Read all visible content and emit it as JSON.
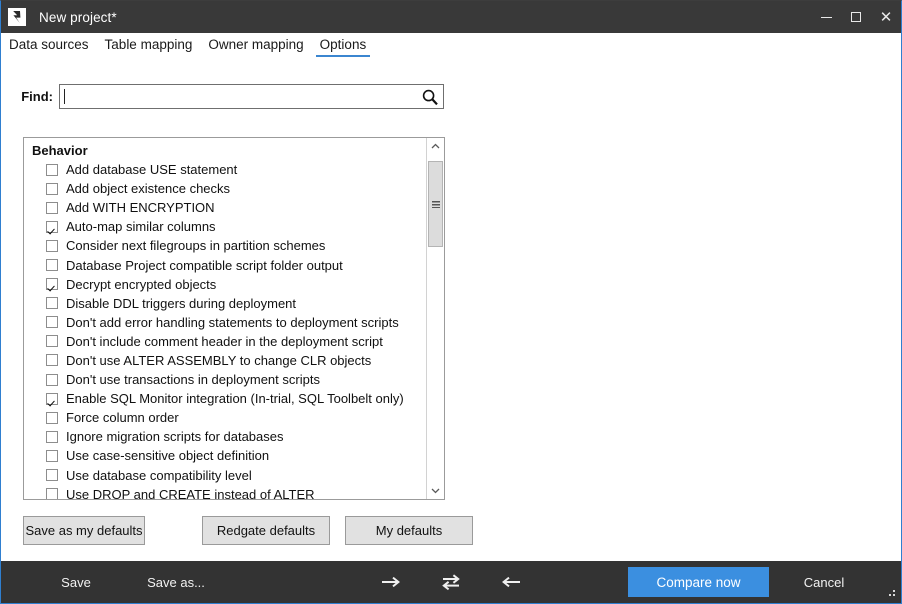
{
  "window": {
    "title": "New project*",
    "logo_icon": "redgate-s-logo-icon",
    "minimize_icon": "minimize-icon",
    "maximize_icon": "maximize-icon",
    "close_icon": "close-icon",
    "titlebar_color": "#393939",
    "accent_color": "#3b86d0"
  },
  "tabs": [
    {
      "label": "Data sources",
      "active": false
    },
    {
      "label": "Table mapping",
      "active": false
    },
    {
      "label": "Owner mapping",
      "active": false
    },
    {
      "label": "Options",
      "active": true
    }
  ],
  "find": {
    "label": "Find:",
    "value": "",
    "placeholder": "",
    "search_icon": "search-icon"
  },
  "options_list": {
    "group_header": "Behavior",
    "items": [
      {
        "label": "Add database USE statement",
        "checked": false
      },
      {
        "label": "Add object existence checks",
        "checked": false
      },
      {
        "label": "Add WITH ENCRYPTION",
        "checked": false
      },
      {
        "label": "Auto-map similar columns",
        "checked": true
      },
      {
        "label": "Consider next filegroups in partition schemes",
        "checked": false
      },
      {
        "label": "Database Project compatible script folder output",
        "checked": false
      },
      {
        "label": "Decrypt encrypted objects",
        "checked": true
      },
      {
        "label": "Disable DDL triggers during deployment",
        "checked": false
      },
      {
        "label": "Don't add error handling statements to deployment scripts",
        "checked": false
      },
      {
        "label": "Don't include comment header in the deployment script",
        "checked": false
      },
      {
        "label": "Don't use ALTER ASSEMBLY to change CLR objects",
        "checked": false
      },
      {
        "label": "Don't use transactions in deployment scripts",
        "checked": false
      },
      {
        "label": "Enable SQL Monitor integration (In-trial, SQL Toolbelt only)",
        "checked": true
      },
      {
        "label": "Force column order",
        "checked": false
      },
      {
        "label": "Ignore migration scripts for databases",
        "checked": false
      },
      {
        "label": "Use case-sensitive object definition",
        "checked": false
      },
      {
        "label": "Use database compatibility level",
        "checked": false
      },
      {
        "label": "Use DROP and CREATE instead of ALTER",
        "checked": false
      }
    ],
    "scrollbar": {
      "up_arrow_icon": "chevron-up-icon",
      "down_arrow_icon": "chevron-down-icon",
      "thumb_icon": "scrollbar-thumb-grip-icon"
    }
  },
  "defaults_buttons": {
    "save_as_my_defaults": "Save as my defaults",
    "redgate_defaults": "Redgate defaults",
    "my_defaults": "My defaults"
  },
  "bottom_bar": {
    "save": "Save",
    "save_as": "Save as...",
    "arrow_right_icon": "arrow-right-icon",
    "swap_icon": "swap-direction-icon",
    "arrow_left_icon": "arrow-left-icon",
    "compare_now": "Compare now",
    "cancel": "Cancel",
    "compare_button_color": "#3b8fe0",
    "resize_grip_icon": "resize-grip-icon"
  }
}
